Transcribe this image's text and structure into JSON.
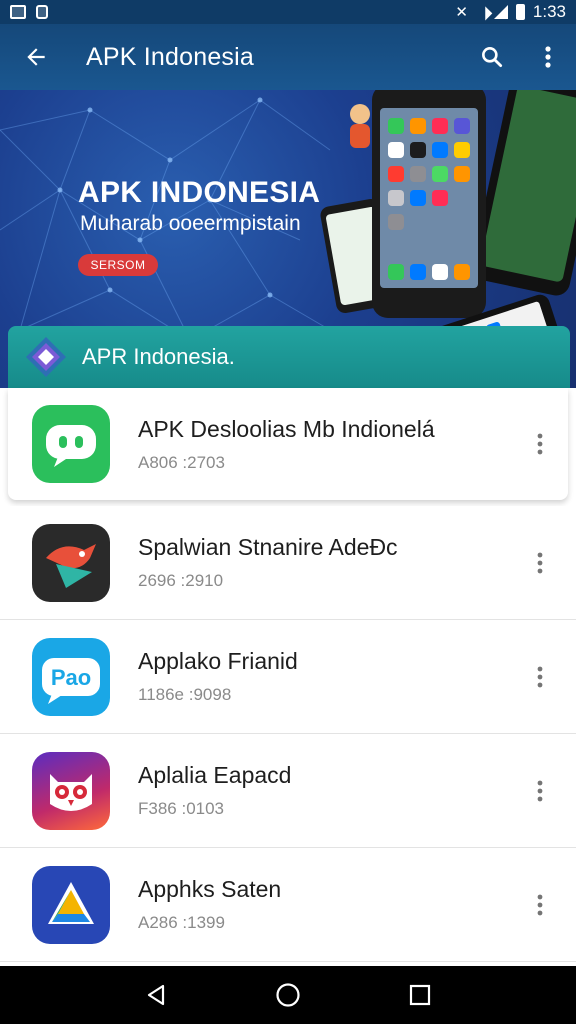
{
  "status_bar": {
    "time": "1:33"
  },
  "app_bar": {
    "title": "APK Indonesia"
  },
  "banner": {
    "title": "APK INDONESIA",
    "subtitle": "Muharab ooeermpistain",
    "button_label": "SERSOM"
  },
  "section": {
    "title": "APR Indonesia."
  },
  "apps": [
    {
      "name": "APK Desloolias Mb Indionelá",
      "meta": "A806 :2703",
      "icon": "chat-bubble-icon",
      "color": "#2bbf5c"
    },
    {
      "name": "Spalwian Stnanire AdeĐc",
      "meta": "2696 :2910",
      "icon": "bird-icon",
      "color": "#2a2a2a"
    },
    {
      "name": "Applako Frianid",
      "meta": "1186e :9098",
      "icon": "speech-bubble-icon",
      "color": "#1aa7e6"
    },
    {
      "name": "Aplalia Eapacd",
      "meta": "F386 :0103",
      "icon": "owl-icon",
      "color": "#7a2ac0"
    },
    {
      "name": "Apphks Saten",
      "meta": "A286 :1399",
      "icon": "triangle-drive-icon",
      "color": "#2847b5"
    }
  ],
  "colors": {
    "app_bar": "#15487a",
    "section": "#1a9594",
    "banner_button": "#d93a3a"
  }
}
